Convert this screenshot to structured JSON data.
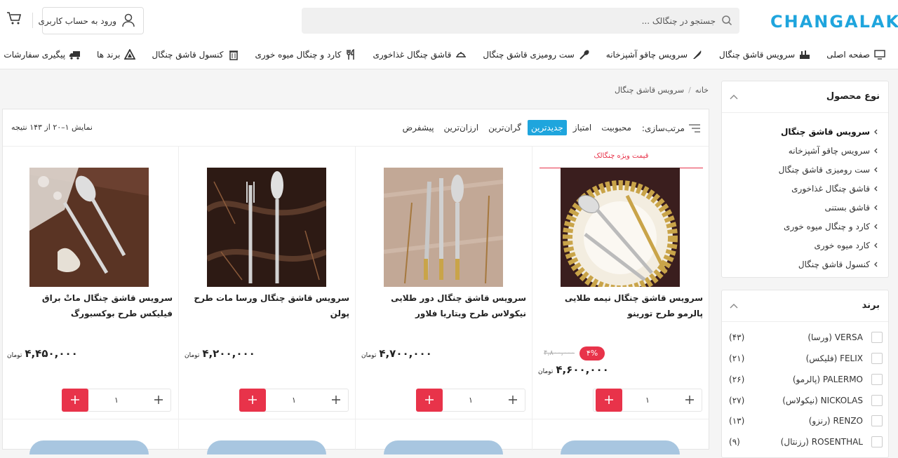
{
  "header": {
    "logo": "CHANGALAK",
    "search_placeholder": "جستجو در چنگالک ...",
    "login_label": "ورود به حساب کاربری"
  },
  "nav": [
    {
      "label": "صفحه اصلی",
      "icon": "monitor-icon"
    },
    {
      "label": "سرویس قاشق چنگال",
      "icon": "cutlery-set-icon"
    },
    {
      "label": "سرویس چاقو آشپزخانه",
      "icon": "knife-icon"
    },
    {
      "label": "ست رومیزی قاشق چنگال",
      "icon": "spoon-icon"
    },
    {
      "label": "قاشق چنگال غذاخوری",
      "icon": "dining-icon"
    },
    {
      "label": "کارد و چنگال میوه خوری",
      "icon": "fork-knife-icon"
    },
    {
      "label": "کنسول قاشق چنگال",
      "icon": "trash-can-icon"
    },
    {
      "label": "برند ها",
      "icon": "brand-icon"
    },
    {
      "label": "پیگیری سفارشات",
      "icon": "truck-icon"
    }
  ],
  "breadcrumb": [
    "خانه",
    "سرویس قاشق چنگال"
  ],
  "sidebar": {
    "category_title": "نوع محصول",
    "categories": [
      "سرویس قاشق چنگال",
      "سرویس چاقو آشپزخانه",
      "ست رومیزی قاشق چنگال",
      "قاشق چنگال غذاخوری",
      "قاشق بستنی",
      "کارد و چنگال میوه خوری",
      "کارد میوه خوری",
      "کنسول قاشق چنگال"
    ],
    "brand_title": "برند",
    "brands": [
      {
        "name": "VERSA (ورسا)",
        "count": "(۴۳)"
      },
      {
        "name": "FELIX (فلیکس)",
        "count": "(۲۱)"
      },
      {
        "name": "PALERMO (پالرمو)",
        "count": "(۲۶)"
      },
      {
        "name": "NICKOLAS (نیکولاس)",
        "count": "(۲۷)"
      },
      {
        "name": "RENZO (رنزو)",
        "count": "(۱۳)"
      },
      {
        "name": "ROSENTHAL (رزنتال)",
        "count": "(۹)"
      }
    ]
  },
  "sortbar": {
    "label": "مرتب‌سازی:",
    "options": [
      "محبوبیت",
      "امتیاز",
      "جدیدترین",
      "گران‌ترین",
      "ارزان‌ترین",
      "پیشفرض"
    ],
    "active": "جدیدترین",
    "result_count": "نمایش ۱–۲۰ از ۱۴۳ نتیجه"
  },
  "products": [
    {
      "title": "سرویس قاشق چنگال نیمه طلایی پالرمو طرح تورینو",
      "price": "۴,۶۰۰,۰۰۰",
      "currency": "تومان",
      "old_price": "۴,۸۰۰,۰۰۰",
      "discount": "۴%",
      "special": "قیمت ویژه چنگالک",
      "qty": "۱"
    },
    {
      "title": "سرویس قاشق چنگال دور طلایی نیکولاس طرح ویتاریا فلاور",
      "price": "۴,۷۰۰,۰۰۰",
      "currency": "تومان",
      "qty": "۱"
    },
    {
      "title": "سرویس قاشق چنگال ورسا مات طرح پولن",
      "price": "۴,۲۰۰,۰۰۰",
      "currency": "تومان",
      "qty": "۱"
    },
    {
      "title": "سرویس قاشق چنگال ماتْ براق فیلیکس طرح بوکسبورگ",
      "price": "۴,۴۵۰,۰۰۰",
      "currency": "تومان",
      "qty": "۱"
    }
  ],
  "colors": {
    "accent": "#1fa5dd",
    "red": "#e8334a"
  }
}
